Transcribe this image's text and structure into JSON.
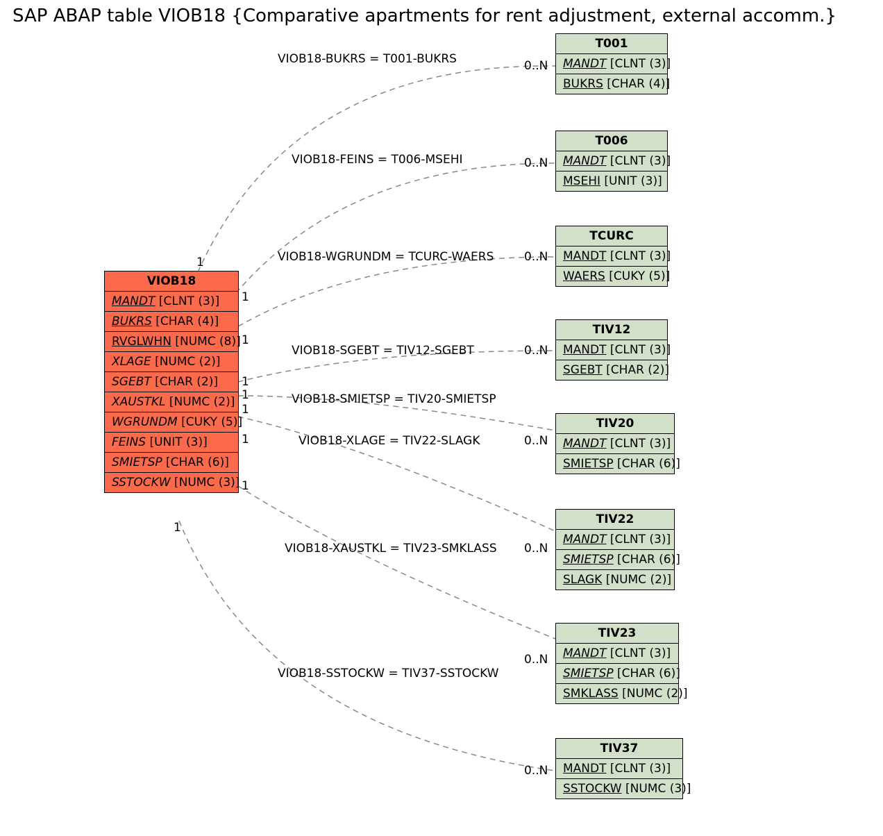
{
  "title": "SAP ABAP table VIOB18 {Comparative apartments for rent adjustment, external accomm.}",
  "main": {
    "name": "VIOB18",
    "fields": [
      {
        "name": "MANDT",
        "type": "[CLNT (3)]",
        "u": true,
        "i": true
      },
      {
        "name": "BUKRS",
        "type": "[CHAR (4)]",
        "u": true,
        "i": true
      },
      {
        "name": "RVGLWHN",
        "type": "[NUMC (8)]",
        "u": true,
        "i": false
      },
      {
        "name": "XLAGE",
        "type": "[NUMC (2)]",
        "u": false,
        "i": true
      },
      {
        "name": "SGEBT",
        "type": "[CHAR (2)]",
        "u": false,
        "i": true
      },
      {
        "name": "XAUSTKL",
        "type": "[NUMC (2)]",
        "u": false,
        "i": true
      },
      {
        "name": "WGRUNDM",
        "type": "[CUKY (5)]",
        "u": false,
        "i": true
      },
      {
        "name": "FEINS",
        "type": "[UNIT (3)]",
        "u": false,
        "i": true
      },
      {
        "name": "SMIETSP",
        "type": "[CHAR (6)]",
        "u": false,
        "i": true
      },
      {
        "name": "SSTOCKW",
        "type": "[NUMC (3)]",
        "u": false,
        "i": true
      }
    ]
  },
  "refs": [
    {
      "name": "T001",
      "fields": [
        {
          "name": "MANDT",
          "type": "[CLNT (3)]",
          "u": true,
          "i": true
        },
        {
          "name": "BUKRS",
          "type": "[CHAR (4)]",
          "u": true,
          "i": false
        }
      ]
    },
    {
      "name": "T006",
      "fields": [
        {
          "name": "MANDT",
          "type": "[CLNT (3)]",
          "u": true,
          "i": true
        },
        {
          "name": "MSEHI",
          "type": "[UNIT (3)]",
          "u": true,
          "i": false
        }
      ]
    },
    {
      "name": "TCURC",
      "fields": [
        {
          "name": "MANDT",
          "type": "[CLNT (3)]",
          "u": true,
          "i": false
        },
        {
          "name": "WAERS",
          "type": "[CUKY (5)]",
          "u": true,
          "i": false
        }
      ]
    },
    {
      "name": "TIV12",
      "fields": [
        {
          "name": "MANDT",
          "type": "[CLNT (3)]",
          "u": true,
          "i": false
        },
        {
          "name": "SGEBT",
          "type": "[CHAR (2)]",
          "u": true,
          "i": false
        }
      ]
    },
    {
      "name": "TIV20",
      "fields": [
        {
          "name": "MANDT",
          "type": "[CLNT (3)]",
          "u": true,
          "i": true
        },
        {
          "name": "SMIETSP",
          "type": "[CHAR (6)]",
          "u": true,
          "i": false
        }
      ]
    },
    {
      "name": "TIV22",
      "fields": [
        {
          "name": "MANDT",
          "type": "[CLNT (3)]",
          "u": true,
          "i": true
        },
        {
          "name": "SMIETSP",
          "type": "[CHAR (6)]",
          "u": true,
          "i": true
        },
        {
          "name": "SLAGK",
          "type": "[NUMC (2)]",
          "u": true,
          "i": false
        }
      ]
    },
    {
      "name": "TIV23",
      "fields": [
        {
          "name": "MANDT",
          "type": "[CLNT (3)]",
          "u": true,
          "i": true
        },
        {
          "name": "SMIETSP",
          "type": "[CHAR (6)]",
          "u": true,
          "i": true
        },
        {
          "name": "SMKLASS",
          "type": "[NUMC (2)]",
          "u": true,
          "i": false
        }
      ]
    },
    {
      "name": "TIV37",
      "fields": [
        {
          "name": "MANDT",
          "type": "[CLNT (3)]",
          "u": true,
          "i": false
        },
        {
          "name": "SSTOCKW",
          "type": "[NUMC (3)]",
          "u": true,
          "i": false
        }
      ]
    }
  ],
  "edges": [
    {
      "label": "VIOB18-BUKRS = T001-BUKRS"
    },
    {
      "label": "VIOB18-FEINS = T006-MSEHI"
    },
    {
      "label": "VIOB18-WGRUNDM = TCURC-WAERS"
    },
    {
      "label": "VIOB18-SGEBT = TIV12-SGEBT"
    },
    {
      "label": "VIOB18-SMIETSP = TIV20-SMIETSP"
    },
    {
      "label": "VIOB18-XLAGE = TIV22-SLAGK"
    },
    {
      "label": "VIOB18-XAUSTKL = TIV23-SMKLASS"
    },
    {
      "label": "VIOB18-SSTOCKW = TIV37-SSTOCKW"
    }
  ],
  "card_src": "1",
  "card_dst": "0..N"
}
